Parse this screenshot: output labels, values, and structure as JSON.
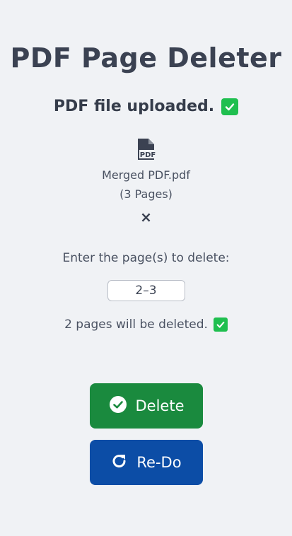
{
  "app": {
    "title": "PDF Page Deleter"
  },
  "upload": {
    "status_text": "PDF file uploaded.",
    "status_icon": "check-icon",
    "file_icon": "pdf-file-icon",
    "file_name": "Merged PDF.pdf",
    "page_count_text": "(3 Pages)",
    "remove_symbol": "×"
  },
  "delete_form": {
    "prompt": "Enter the page(s) to delete:",
    "pages_value": "2–3",
    "result_text": "2 pages will be deleted.",
    "result_icon": "check-icon"
  },
  "buttons": {
    "delete_label": "Delete",
    "delete_icon": "check-circle-icon",
    "redo_label": "Re-Do",
    "redo_icon": "redo-icon"
  },
  "colors": {
    "background": "#f0f2f5",
    "success_check": "#1fbf4f",
    "delete_button": "#1a8a3e",
    "redo_button": "#0c4da6"
  }
}
